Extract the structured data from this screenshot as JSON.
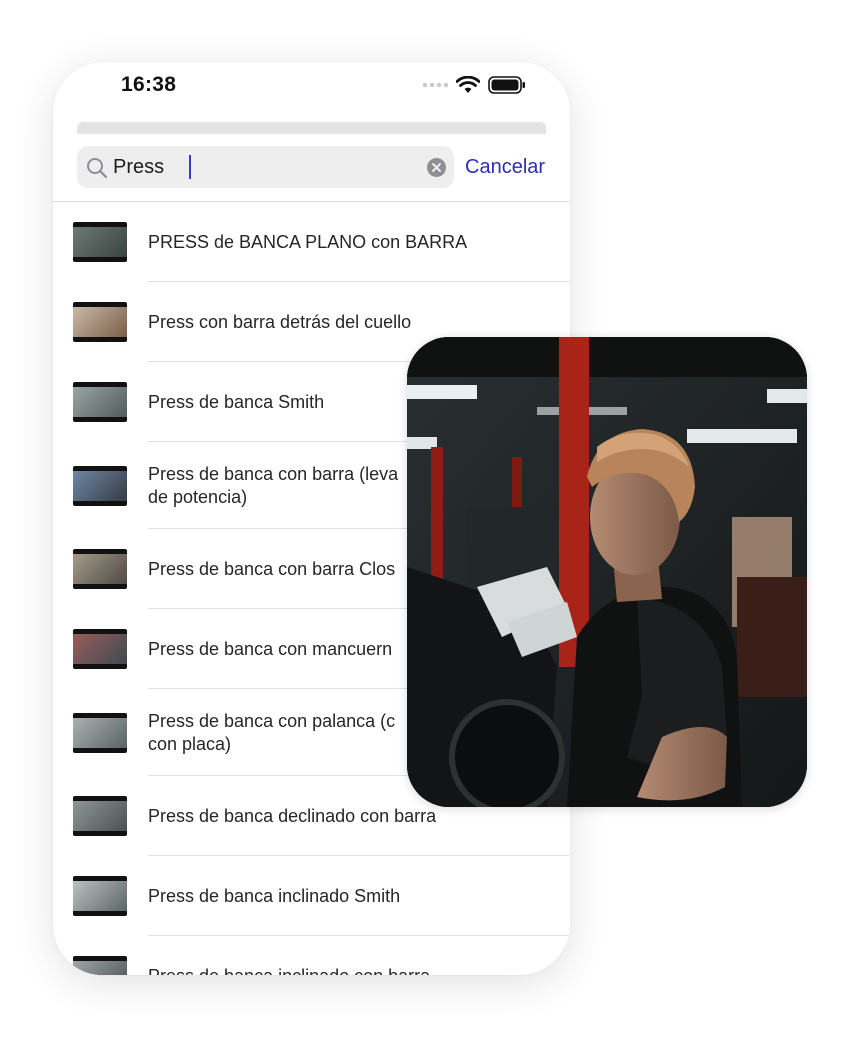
{
  "status_bar": {
    "time": "16:38",
    "icons": [
      "signal-dots-icon",
      "wifi-icon",
      "battery-icon"
    ]
  },
  "search": {
    "value": "Press",
    "cancel_label": "Cancelar"
  },
  "colors": {
    "accent": "#2d2fb0",
    "search_bg": "#eeeeef",
    "divider": "#e2e2e5"
  },
  "results": [
    {
      "lines": [
        "PRESS de BANCA PLANO con BARRA"
      ]
    },
    {
      "lines": [
        "Press con barra detrás del cuello"
      ]
    },
    {
      "lines": [
        "Press de banca Smith"
      ]
    },
    {
      "lines": [
        "Press de banca con barra (leva",
        "de potencia)"
      ]
    },
    {
      "lines": [
        "Press de banca con barra Clos"
      ]
    },
    {
      "lines": [
        "Press de banca con mancuern"
      ]
    },
    {
      "lines": [
        "Press de banca con palanca (c",
        "con placa)"
      ]
    },
    {
      "lines": [
        "Press de banca declinado con barra"
      ]
    },
    {
      "lines": [
        "Press de banca inclinado Smith"
      ]
    },
    {
      "lines": [
        "Press de banca inclinado con barra"
      ]
    }
  ],
  "photo": {
    "subject": "man-in-gym-photo"
  }
}
